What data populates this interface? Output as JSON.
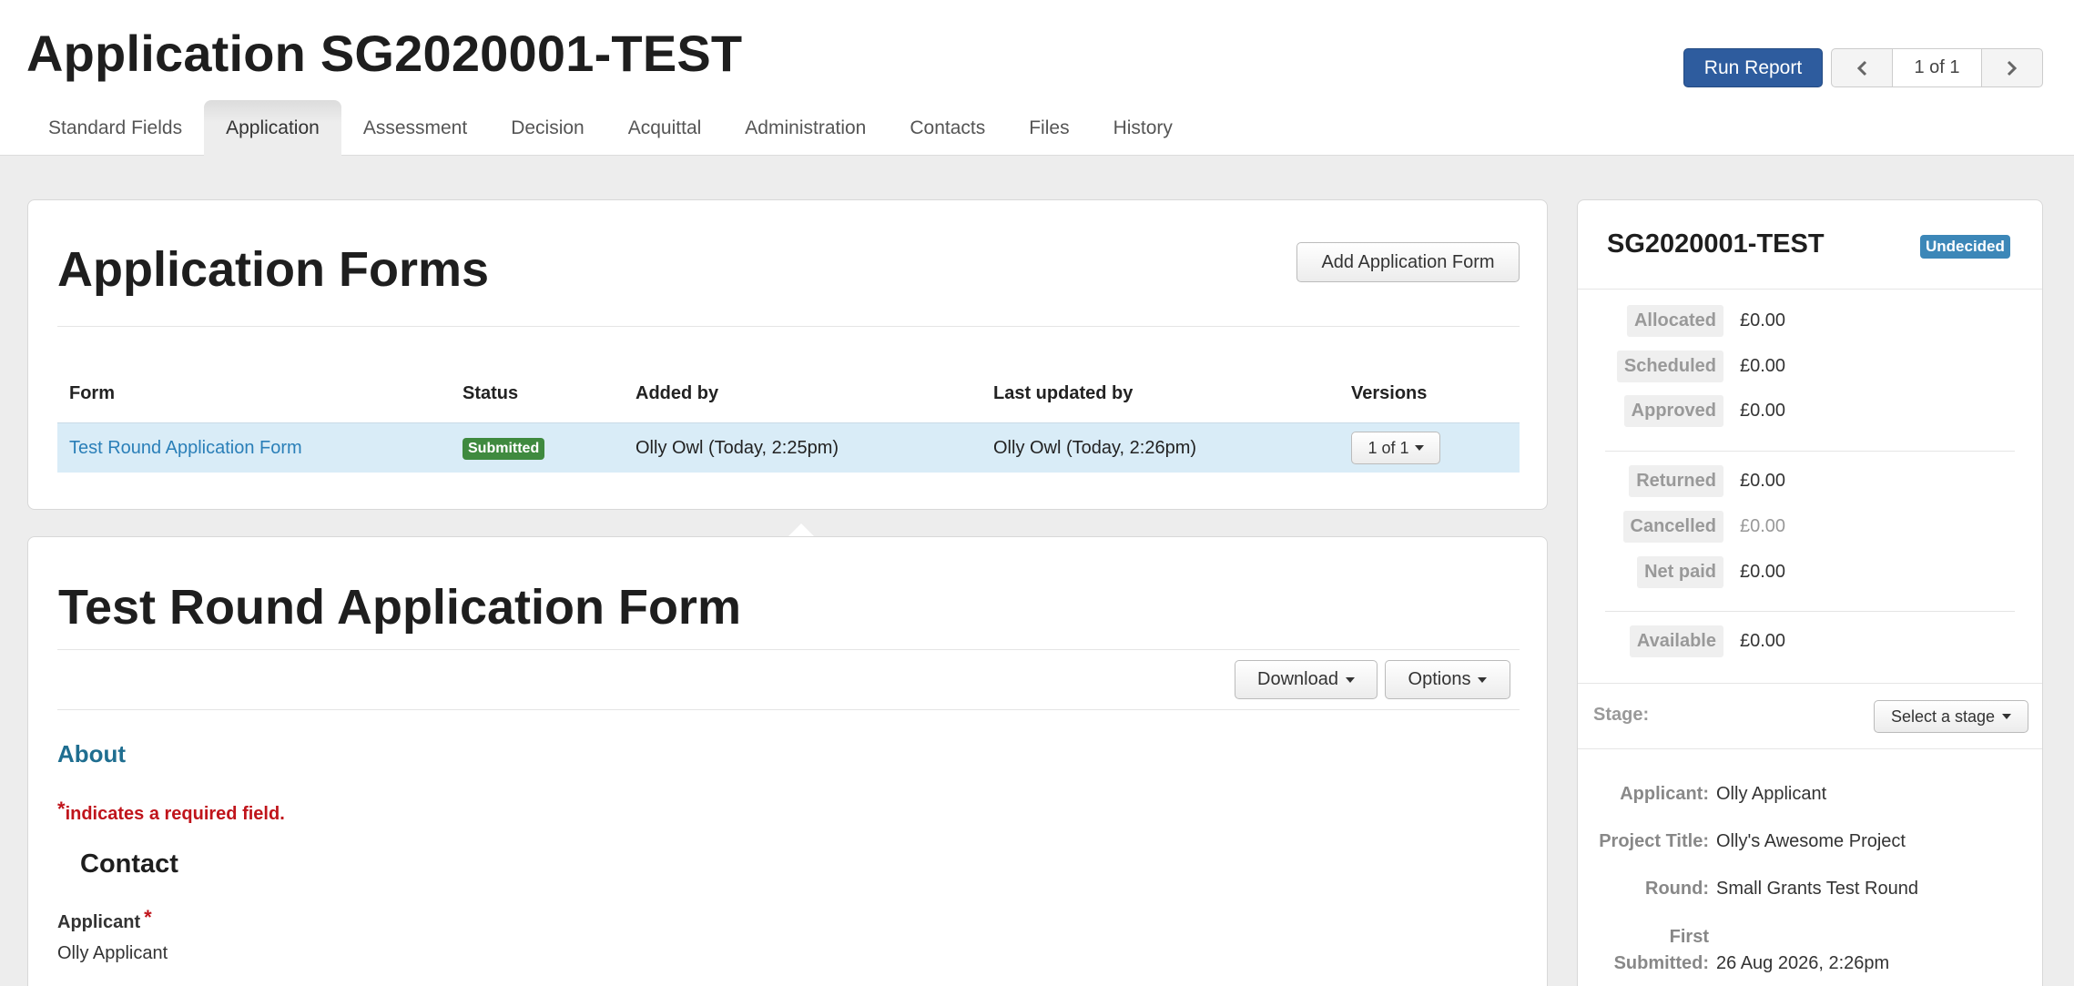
{
  "header": {
    "title": "Application SG2020001-TEST",
    "run_report_label": "Run Report",
    "pager": {
      "count": "1 of 1"
    },
    "tabs": [
      {
        "label": "Standard Fields",
        "active": false
      },
      {
        "label": "Application",
        "active": true
      },
      {
        "label": "Assessment",
        "active": false
      },
      {
        "label": "Decision",
        "active": false
      },
      {
        "label": "Acquittal",
        "active": false
      },
      {
        "label": "Administration",
        "active": false
      },
      {
        "label": "Contacts",
        "active": false
      },
      {
        "label": "Files",
        "active": false
      },
      {
        "label": "History",
        "active": false
      }
    ]
  },
  "forms_panel": {
    "title": "Application Forms",
    "add_button_label": "Add Application Form",
    "columns": [
      "Form",
      "Status",
      "Added by",
      "Last updated by",
      "Versions"
    ],
    "rows": [
      {
        "form": "Test Round Application Form",
        "status": "Submitted",
        "added_by": "Olly Owl (Today, 2:25pm)",
        "last_updated_by": "Olly Owl (Today, 2:26pm)",
        "versions": "1 of 1"
      }
    ]
  },
  "form_panel": {
    "title": "Test Round Application Form",
    "download_label": "Download",
    "options_label": "Options",
    "section_title": "About",
    "required_star": "*",
    "required_note": "indicates a required field.",
    "contact_heading": "Contact",
    "applicant_label": "Applicant",
    "applicant_star": "*",
    "applicant_value": "Olly Applicant"
  },
  "sidebar": {
    "title": "SG2020001-TEST",
    "status_badge": "Undecided",
    "financials": [
      {
        "label": "Allocated",
        "value": "£0.00"
      },
      {
        "label": "Scheduled",
        "value": "£0.00"
      },
      {
        "label": "Approved",
        "value": "£0.00"
      },
      {
        "label": "Returned",
        "value": "£0.00"
      },
      {
        "label": "Cancelled",
        "value": "£0.00"
      },
      {
        "label": "Net paid",
        "value": "£0.00"
      },
      {
        "label": "Available",
        "value": "£0.00"
      }
    ],
    "stage_label": "Stage:",
    "stage_select": "Select a stage",
    "info": {
      "applicant_label": "Applicant:",
      "applicant_value": "Olly Applicant",
      "project_label": "Project Title:",
      "project_value": "Olly's Awesome Project",
      "round_label": "Round:",
      "round_value": "Small Grants Test Round",
      "first_label_1": "First",
      "first_label_2": "Submitted:",
      "first_value": "26 Aug 2026, 2:26pm"
    }
  },
  "colors": {
    "primary": "#2e5c9e",
    "link": "#2a7fb8",
    "submitted": "#3f8a3f",
    "undecided": "#3c87b8",
    "required": "#c0141b",
    "row_highlight": "#d9ecf7"
  }
}
